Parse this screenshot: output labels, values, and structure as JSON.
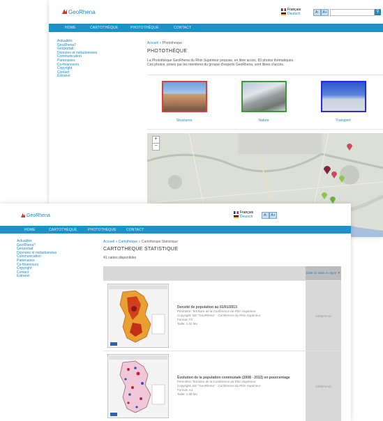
{
  "site": {
    "name": "GeoRhena"
  },
  "languages": [
    {
      "label": "Français"
    },
    {
      "label": "Deutsch"
    }
  ],
  "font_buttons": [
    "A-",
    "A+"
  ],
  "nav": [
    "HOME",
    "CARTOTHÈQUE",
    "PHOTOTHÈQUE",
    "CONTACT"
  ],
  "sidebar": [
    "Actualités",
    "GeoRhena?",
    "Géoportail",
    "Données et métadonnées",
    "Communication",
    "Partenaires",
    "Co-financeurs",
    "Copyright",
    "Contact",
    "Extranet"
  ],
  "phototheque": {
    "breadcrumb": {
      "home": "Accueil",
      "sep": "»",
      "current": "Photothèque"
    },
    "title": "PHOTOTHÈQUE",
    "intro_1": "La Photothèque GeoRhena du Rhin Supérieur propose, en libre accès, 83 photos thématiques.",
    "intro_2": "Ces photos, prises par les membres du groupe d'experts GeoRhena, sont libres d'accès.",
    "categories": [
      {
        "label": "Structures",
        "border": "#e03c3c"
      },
      {
        "label": "Nature",
        "border": "#3a9a3a"
      },
      {
        "label": "Transport",
        "border": "#2a2ae0"
      }
    ]
  },
  "cartotheque": {
    "breadcrumb": {
      "home": "Accueil",
      "mid": "Cartothèque",
      "sep": "»",
      "current": "Cartothèque Statistique"
    },
    "title": "CARTOTHEQUE STATISTIQUE",
    "count": "41 cartes disponibles",
    "sort_header": "Date de mise en ligne ▼",
    "rows": [
      {
        "title": "Densité de population au 01/01/2013",
        "lines": [
          "Périmètre: Territoire de la Conférence du Rhin Supérieur",
          "Copyright: GE \"GeoRhena\" - Conférence du Rhin Supérieur",
          "Format: A4",
          "Taille: 1.02 Mo"
        ],
        "date": "04/02/2016"
      },
      {
        "title": "Évolution de la population communale (2008 - 2013) en pourcentage",
        "lines": [
          "Périmètre: Territoire de la Conférence du Rhin Supérieur",
          "Copyright: GE \"GeoRhena\" - Conférence du Rhin Supérieur",
          "Format: A4",
          "Taille: 1.08 Mo"
        ],
        "date": "04/02/2016"
      }
    ]
  },
  "colors": {
    "accent": "#1e90c8",
    "link": "#1e88c8",
    "logo_red": "#d23a2a"
  },
  "icons": [
    "logo-icon",
    "search-icon",
    "map-marker-icon"
  ]
}
